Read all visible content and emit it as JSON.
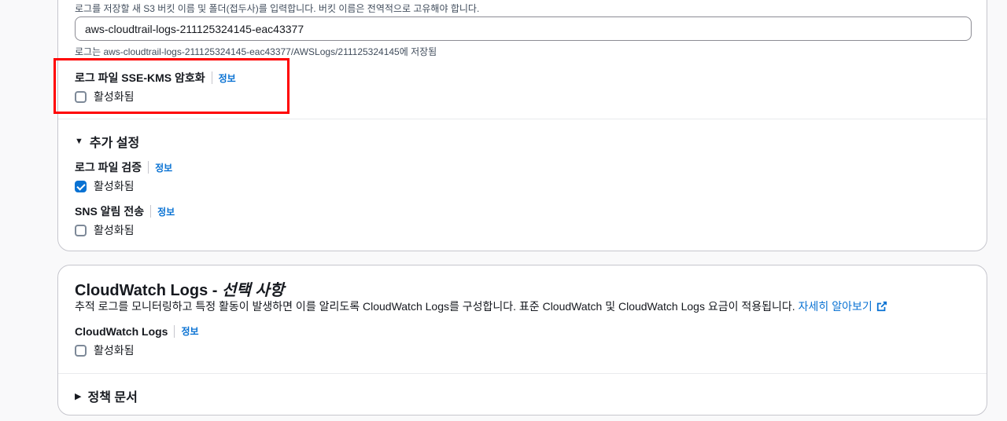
{
  "storage": {
    "bucket_hint": "로그를 저장할 새 S3 버킷 이름 및 폴더(접두사)를 입력합니다. 버킷 이름은 전역적으로 고유해야 합니다.",
    "bucket_name": "aws-cloudtrail-logs-211125324145-eac43377",
    "path_hint": "로그는 aws-cloudtrail-logs-211125324145-eac43377/AWSLogs/211125324145에 저장됨"
  },
  "sse_kms": {
    "label": "로그 파일 SSE-KMS 암호화",
    "info": "정보",
    "checkbox_label": "활성화됨",
    "checked": false
  },
  "additional_settings": {
    "label": "추가 설정",
    "expanded": true,
    "log_validation": {
      "label": "로그 파일 검증",
      "info": "정보",
      "checkbox_label": "활성화됨",
      "checked": true
    },
    "sns": {
      "label": "SNS 알림 전송",
      "info": "정보",
      "checkbox_label": "활성화됨",
      "checked": false
    }
  },
  "cloudwatch": {
    "title": "CloudWatch Logs",
    "title_dash": " - ",
    "title_optional": "선택 사항",
    "description": "추적 로그를 모니터링하고 특정 활동이 발생하면 이를 알리도록 CloudWatch Logs를 구성합니다. 표준 CloudWatch 및 CloudWatch Logs 요금이 적용됩니다.",
    "learn_more": "자세히 알아보기",
    "field_label": "CloudWatch Logs",
    "info": "정보",
    "checkbox_label": "활성화됨",
    "checked": false
  },
  "policy": {
    "label": "정책 문서",
    "expanded": false
  },
  "colors": {
    "link": "#0972d3",
    "highlight": "#ff0000",
    "checkbox_checked": "#0972d3"
  },
  "icons": {
    "expanded_caret": "caret-down-icon",
    "collapsed_caret": "caret-right-icon",
    "external_link": "external-link-icon"
  }
}
